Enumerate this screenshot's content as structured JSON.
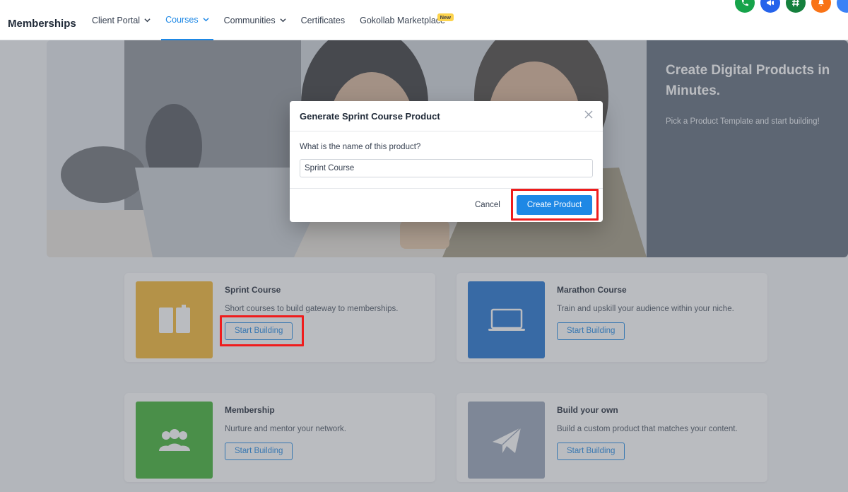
{
  "header": {
    "brand": "Memberships",
    "nav": [
      {
        "label": "Client Portal",
        "has_dropdown": true,
        "active": false
      },
      {
        "label": "Courses",
        "has_dropdown": true,
        "active": true
      },
      {
        "label": "Communities",
        "has_dropdown": true,
        "active": false
      },
      {
        "label": "Certificates",
        "has_dropdown": false,
        "active": false
      },
      {
        "label": "Gokollab Marketplace",
        "has_dropdown": false,
        "active": false,
        "badge": "New"
      }
    ],
    "icons": [
      {
        "name": "phone-icon",
        "color": "#16a34a"
      },
      {
        "name": "megaphone-icon",
        "color": "#2563eb"
      },
      {
        "name": "hashtag-icon",
        "color": "#15803d"
      },
      {
        "name": "bell-icon",
        "color": "#f97316"
      },
      {
        "name": "avatar-icon",
        "color": "#3b82f6"
      }
    ]
  },
  "hero": {
    "title": "Create Digital Products in Minutes.",
    "subtitle": "Pick a Product Template and start building!"
  },
  "cards": [
    {
      "title": "Sprint Course",
      "description": "Short courses to build gateway to memberships.",
      "button": "Start Building",
      "icon": "book-icon",
      "color": "#f5b731"
    },
    {
      "title": "Marathon Course",
      "description": "Train and upskill your audience within your niche.",
      "button": "Start Building",
      "icon": "laptop-icon",
      "color": "#1f73d0"
    },
    {
      "title": "Membership",
      "description": "Nurture and mentor your network.",
      "button": "Start Building",
      "icon": "users-icon",
      "color": "#3fb233"
    },
    {
      "title": "Build your own",
      "description": "Build a custom product that matches your content.",
      "button": "Start Building",
      "icon": "paper-plane-icon",
      "color": "#98a4b8"
    }
  ],
  "modal": {
    "title": "Generate Sprint Course Product",
    "label": "What is the name of this product?",
    "input_value": "Sprint Course",
    "cancel": "Cancel",
    "submit": "Create Product"
  },
  "colors": {
    "accent": "#1e88e5",
    "highlight": "#ef1c1c"
  }
}
